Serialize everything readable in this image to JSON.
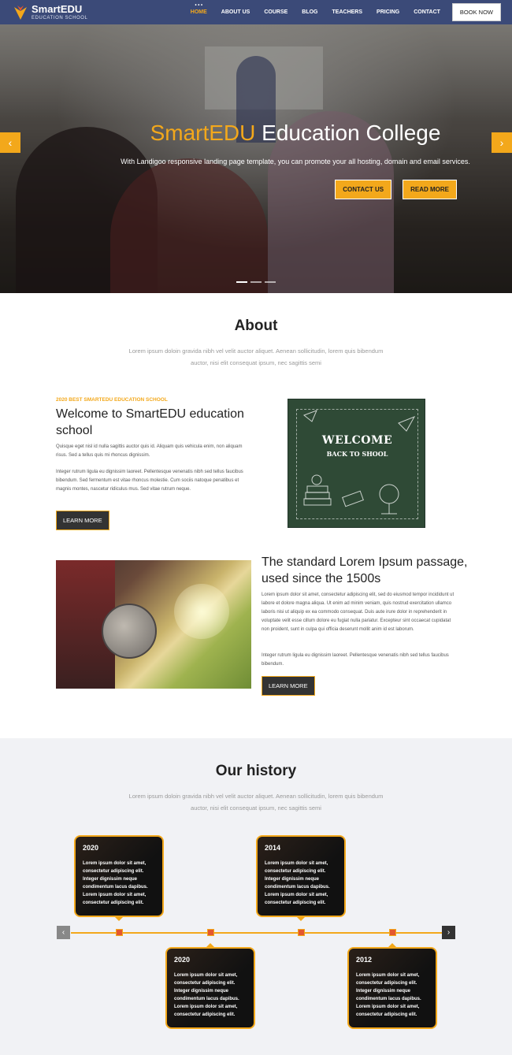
{
  "brand": {
    "title": "SmartEDU",
    "subtitle": "EDUCATION SCHOOL"
  },
  "nav": {
    "items": [
      {
        "label": "HOME",
        "active": true
      },
      {
        "label": "ABOUT US",
        "active": false
      },
      {
        "label": "COURSE",
        "active": false
      },
      {
        "label": "BLOG",
        "active": false
      },
      {
        "label": "TEACHERS",
        "active": false
      },
      {
        "label": "PRICING",
        "active": false
      },
      {
        "label": "CONTACT",
        "active": false
      }
    ],
    "book_label": "BOOK NOW"
  },
  "hero": {
    "title_accent": "SmartEDU",
    "title_rest": " Education College",
    "subtitle": "With Landigoo responsive landing page template, you can promote your all hosting, domain and email services.",
    "contact_label": "CONTACT US",
    "read_more_label": "READ MORE",
    "prev_icon": "chevron-left-icon",
    "next_icon": "chevron-right-icon"
  },
  "about": {
    "title": "About",
    "desc": "Lorem ipsum doloin gravida nibh vel velit auctor aliquet. Aenean sollicitudin, lorem quis bibendum auctor, nisi elit consequat ipsum, nec sagittis semi",
    "kicker": "2020 BEST SMARTEDU EDUCATION SCHOOL",
    "heading": "Welcome to SmartEDU education school",
    "para1": "Quisque eget nisl id nulla sagittis auctor quis id. Aliquam quis vehicula enim, non aliquam risus. Sed a tellus quis mi rhoncus dignissim.",
    "para2": "Integer rutrum ligula eu dignissim laoreet. Pellentesque venenatis nibh sed tellus faucibus bibendum. Sed fermentum est vitae rhoncus molestie. Cum sociis natoque penatibus et magnis montes, nascetur ridiculus mus. Sed vitae rutrum neque.",
    "learn_more": "LEARN MORE",
    "image_text_1": "WELCOME",
    "image_text_2": "BACK TO SHOOL"
  },
  "standard": {
    "heading": "The standard Lorem Ipsum passage, used since the 1500s",
    "para1": "Lorem ipsum dolor sit amet, consectetur adipiscing elit, sed do eiusmod tempor incididunt ut labore et dolore magna aliqua. Ut enim ad minim veniam, quis nostrud exercitation ullamco laboris nisi ut aliquip ex ea commodo consequat. Duis aute irure dolor in reprehenderit in voluptate velit esse cillum dolore eu fugiat nulla pariatur. Excepteur sint occaecat cupidatat non proident, sunt in culpa qui officia deserunt mollit anim id est laborum.",
    "para2": "Integer rutrum ligula eu dignissim laoreet. Pellentesque venenatis nibh sed tellus faucibus bibendum.",
    "learn_more": "LEARN MORE"
  },
  "history": {
    "title": "Our history",
    "desc": "Lorem ipsum doloin gravida nibh vel velit auctor aliquet. Aenean sollicitudin, lorem quis bibendum auctor, nisi elit consequat ipsum, nec sagittis semi",
    "card_text": "Lorem ipsum dolor sit amet, consectetur adipiscing elit. Integer dignissim neque condimentum lacus dapibus. Lorem ipsum dolor sit amet, consectetur adipiscing elit.",
    "cards": [
      {
        "year": "2020"
      },
      {
        "year": "2014"
      },
      {
        "year": "2020"
      },
      {
        "year": "2012"
      }
    ],
    "prev_icon": "chevron-left-icon",
    "next_icon": "chevron-right-icon"
  },
  "colors": {
    "accent": "#f3a81b",
    "nav_bg": "#3b4a78",
    "marker": "#e4572e"
  }
}
